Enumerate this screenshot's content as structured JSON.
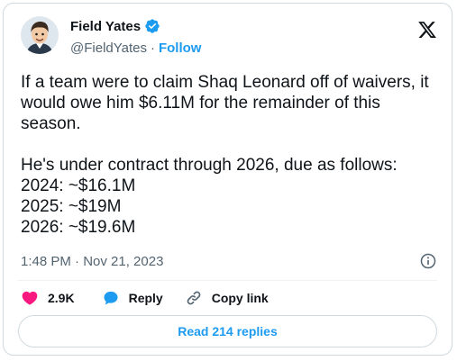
{
  "author": {
    "display_name": "Field Yates",
    "handle": "@FieldYates",
    "separator": "·",
    "follow_label": "Follow",
    "avatar_icon": "cartoon-avatar-icon",
    "verified_icon": "verified-badge-icon"
  },
  "brand": {
    "logo_icon": "x-logo-icon"
  },
  "tweet": {
    "text": "If a team were to claim Shaq Leonard off of waivers, it would owe him $6.11M for the remainder of this season.\n\nHe's under contract through 2026, due as follows:\n2024: ~$16.1M\n2025: ~$19M\n2026: ~$19.6M",
    "timestamp": "1:48 PM · Nov 21, 2023"
  },
  "actions": {
    "likes_count": "2.9K",
    "reply_label": "Reply",
    "copy_link_label": "Copy link",
    "read_replies_label": "Read 214 replies"
  },
  "colors": {
    "accent": "#1d9bf0",
    "like": "#f91880",
    "text": "#0f1419",
    "muted": "#536471",
    "border": "#cfd9de"
  }
}
